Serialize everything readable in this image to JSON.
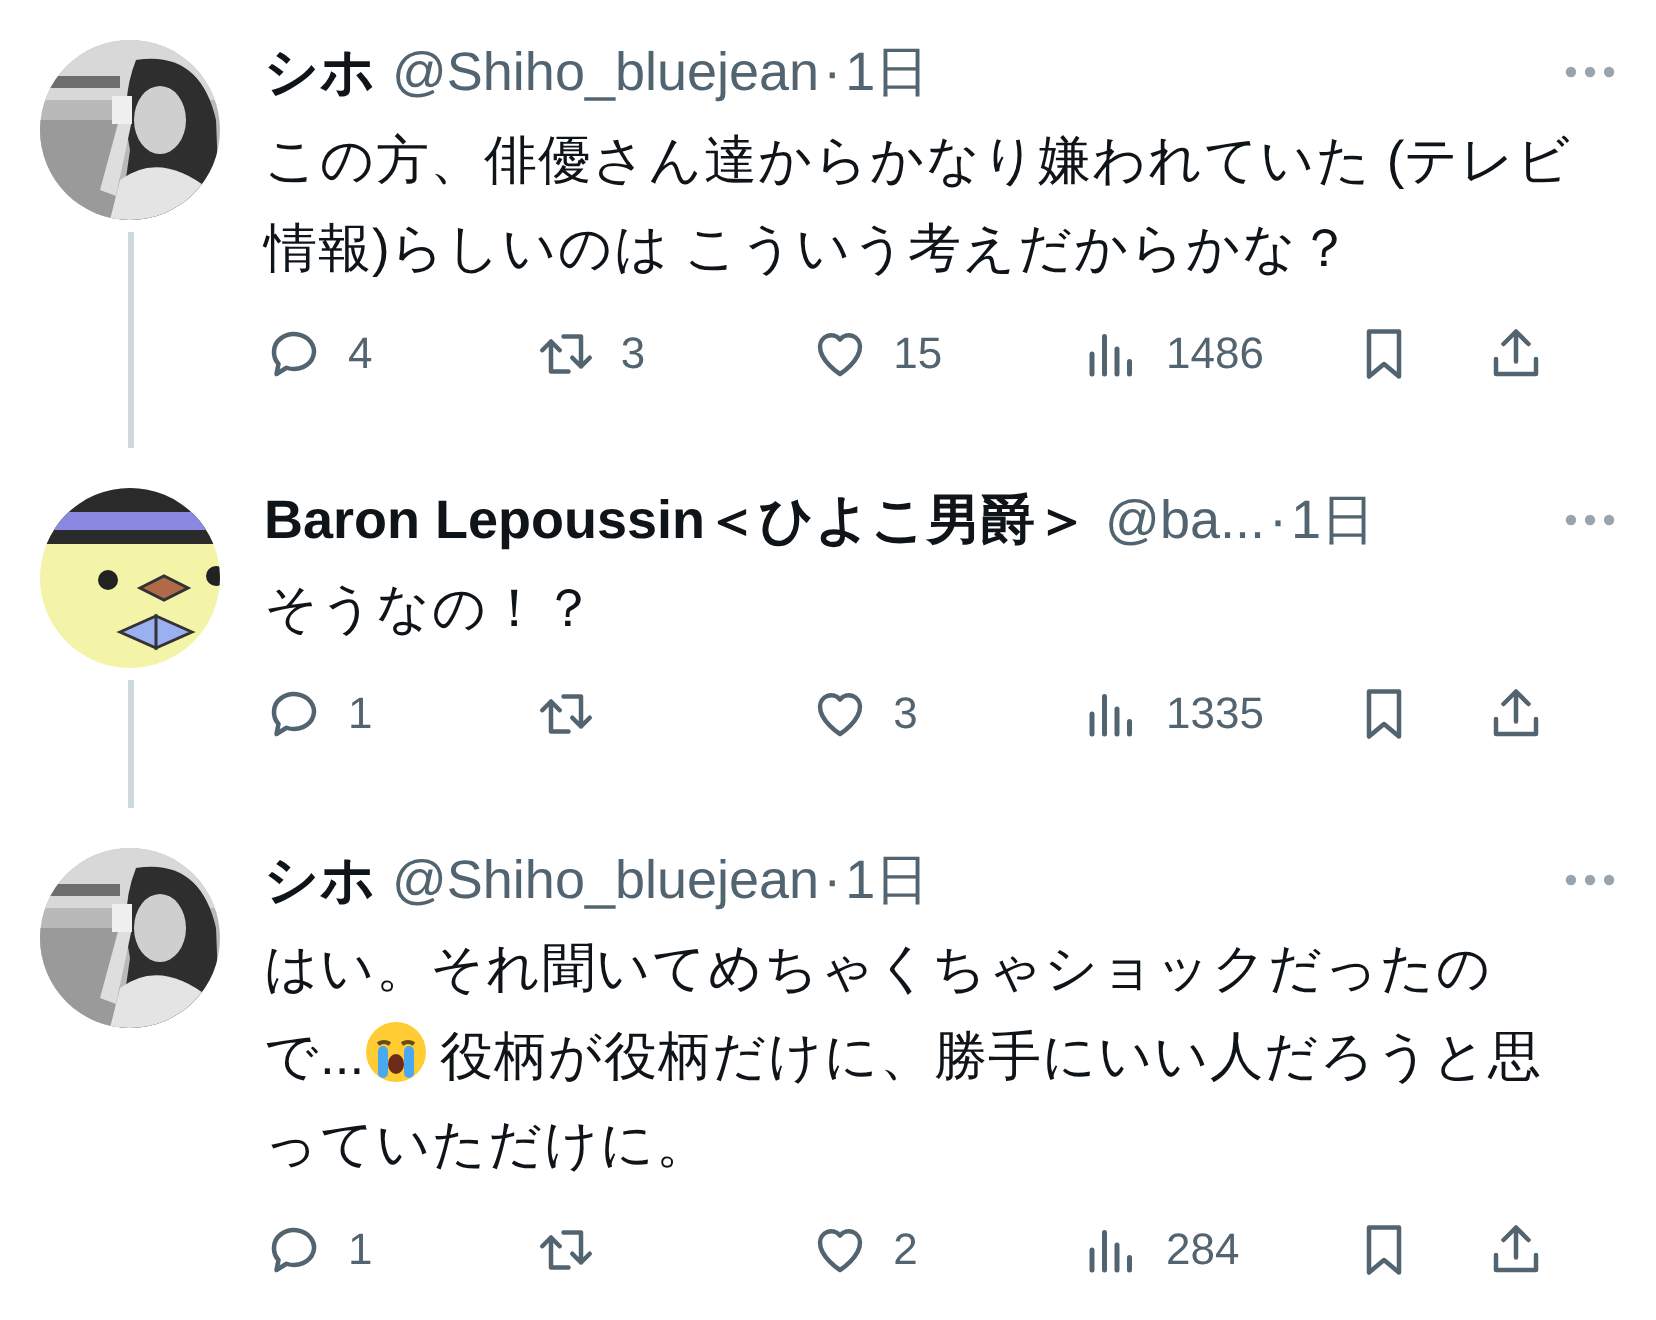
{
  "tweets": [
    {
      "connected": true,
      "name": "シホ",
      "handle": "@Shiho_bluejean",
      "separator": "·",
      "time": "1日",
      "body": [
        {
          "kind": "text",
          "text": "この方、俳優さん達からかなり嫌われていた (テレビ情報)らしいのは こういう考えだからかな？"
        }
      ],
      "replies": "4",
      "reposts": "3",
      "likes": "15",
      "views": "1486"
    },
    {
      "avatar": {
        "kind": "chick"
      },
      "connected": true,
      "name": "Baron Lepoussin＜ひよこ男爵＞",
      "handle": "@ba...",
      "separator": "·",
      "time": "1日",
      "body": [
        {
          "kind": "text",
          "text": "そうなの！？"
        }
      ],
      "replies": "1",
      "likes": "3",
      "views": "1335"
    },
    {
      "connected": false,
      "name": "シホ",
      "handle": "@Shiho_bluejean",
      "separator": "·",
      "time": "1日",
      "body": [
        {
          "kind": "text",
          "text": "はい。それ聞いてめちゃくちゃショックだったので..."
        },
        {
          "kind": "emoji"
        },
        {
          "kind": "text",
          "text": "役柄が役柄だけに、勝手にいい人だろうと思っていただけに。"
        }
      ],
      "replies": "1",
      "likes": "2",
      "views": "284"
    }
  ]
}
